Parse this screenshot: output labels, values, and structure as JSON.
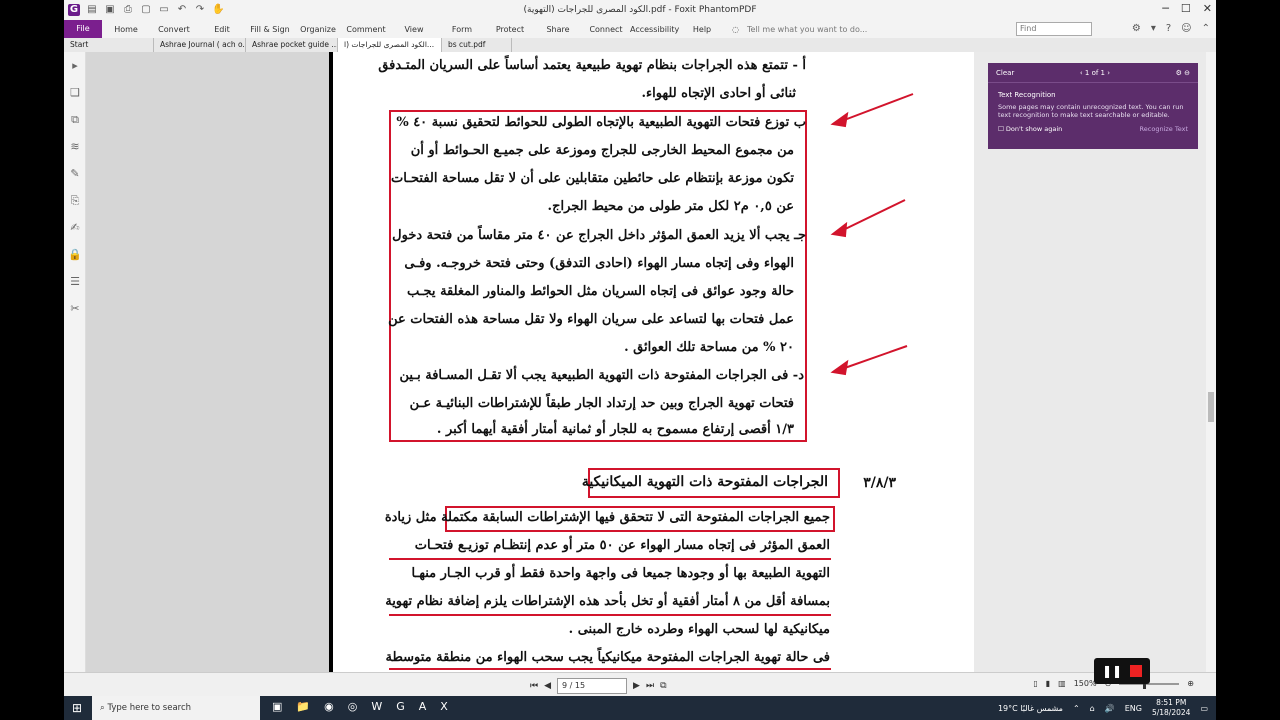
{
  "titlebar": {
    "title": "الكود المصرى للجراجات (التهوية).pdf - Foxit PhantomPDF"
  },
  "menu": {
    "file": "File",
    "items": [
      "Home",
      "Convert",
      "Edit",
      "Fill & Sign",
      "Organize",
      "Comment",
      "View",
      "Form",
      "Protect",
      "Share",
      "Connect",
      "Accessibility",
      "Help"
    ],
    "tell_me": "Tell me what you want to do...",
    "find_placeholder": "Find"
  },
  "tabs": [
    "Start",
    "Ashrae Journal ( ach o...",
    "Ashrae pocket guide ...",
    "الكود المصرى للجراجات (ا...",
    "bs cut.pdf"
  ],
  "doc": {
    "line1": "أ -  تتمتع هذه الجراجات بنظام تهوية طبيعية يعتمد أساساً على السريان المتـدفق",
    "line2": "ثنائى أو احادى الإتجاه للهواء.",
    "b1": "ب  توزع فتحات التهوية الطبيعية بالإتجاه الطولى للحوائط لتحقيق نسبة ٤٠ %",
    "b2": "من مجموع المحيط الخارجى للجراج وموزعة على جميـع الحـوائط أو أن",
    "b3": "تكون موزعة بإنتظام على حائطين متقابلين على أن لا تقل مساحة الفتحـات",
    "b4": "عن ٠,٥ م٢ لكل متر طولى من محيط الجراج.",
    "c1": "جـ  يجب ألا يزيد العمق المؤثر داخل الجراج عن ٤٠ متر مقاساً من فتحة دخول",
    "c2": "الهواء وفى إتجاه مسار الهواء (احادى التدفق) وحتى فتحة خروجـه. وفـى",
    "c3": "حالة وجود عوائق فى إتجاه السريان مثل الحوائط والمناور المغلقة يجـب",
    "c4": "عمل فتحات بها لتساعد على سريان الهواء ولا تقل مساحة هذه الفتحات عن",
    "c5": "٢٠ % من مساحة تلك العوائق .",
    "d1": "د-  فى الجراجات المفتوحة ذات التهوية الطبيعية يجب ألا تقـل المسـافة بـين",
    "d2": "فتحات تهوية الجراج وبين حد إرتداد الجار طبقاً للإشتراطات البنائيـة عـن",
    "d3": "١/٣ أقصى إرتفاع مسموح به للجار أو ثمانية أمتار أفقية أيهما أكبر .",
    "section_num": "٣/٨/٣",
    "section_title": "الجراجات المفتوحة ذات التهوية الميكانيكية",
    "e1": "جميع الجراجات المفتوحة التى لا تتحقق فيها الإشتراطات السابقة مكتملة مثل زيادة",
    "e2": "العمق المؤثر فى إتجاه مسار الهواء عن ٥٠ متر أو عدم إنتظـام توزيـع فتحـات",
    "e3": "التهوية الطبيعة بها أو وجودها جميعا فى واجهة واحدة فقط أو قرب الجـار منهـا",
    "e4": "بمسافة أقل من ٨ أمتار أفقية أو تخل بأحد هذه الإشتراطات يلزم إضافة نظام تهوية",
    "e5": "ميكانيكية لها لسحب الهواء وطرده خارج المبنى .",
    "e6": "فى حالة تهوية الجراجات المفتوحة ميكانيكياً يجب سحب الهواء من منطقة متوسطة"
  },
  "panel": {
    "clear": "Clear",
    "pager": "1 of 1",
    "title": "Text Recognition",
    "body": "Some pages may contain unrecognized text. You can run text recognition to make text searchable or editable.",
    "dont_show": "Don't show again",
    "recognize": "Recognize Text"
  },
  "status": {
    "page": "9 / 15",
    "zoom": "150%"
  },
  "taskbar": {
    "search": "Type here to search",
    "weather": "19°C  مشمس غالبًا",
    "lang": "ENG",
    "time": "8:51 PM",
    "date": "5/18/2024"
  }
}
